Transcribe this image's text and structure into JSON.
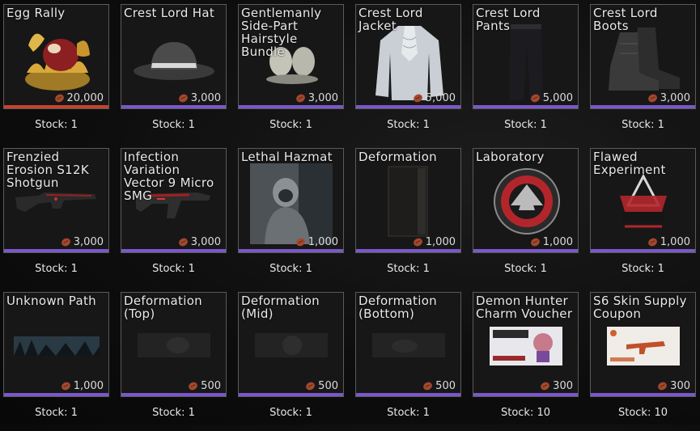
{
  "store": {
    "currency_icon": "crimson-coin-icon",
    "items": [
      {
        "name": "Egg Rally",
        "price": "20,000",
        "stock": "Stock: 1",
        "rarity_color": "#c5432c",
        "icon": "golden-egg-nest"
      },
      {
        "name": "Crest Lord Hat",
        "price": "3,000",
        "stock": "Stock: 1",
        "rarity_color": "#7a58c8",
        "icon": "fedora-hat"
      },
      {
        "name": "Gentlemanly Side-Part Hairstyle Bundle",
        "price": "3,000",
        "stock": "Stock: 1",
        "rarity_color": "#7a58c8",
        "icon": "hairstyle-bundle"
      },
      {
        "name": "Crest Lord Jacket",
        "price": "5,000",
        "stock": "Stock: 1",
        "rarity_color": "#7a58c8",
        "icon": "ruffled-shirt"
      },
      {
        "name": "Crest Lord Pants",
        "price": "5,000",
        "stock": "Stock: 1",
        "rarity_color": "#7a58c8",
        "icon": "dark-pants"
      },
      {
        "name": "Crest Lord Boots",
        "price": "3,000",
        "stock": "Stock: 1",
        "rarity_color": "#7a58c8",
        "icon": "leather-boots"
      },
      {
        "name": "Frenzied Erosion S12K Shotgun",
        "price": "3,000",
        "stock": "Stock: 1",
        "rarity_color": "#7a58c8",
        "icon": "shotgun"
      },
      {
        "name": "Infection Variation Vector 9 Micro SMG",
        "price": "3,000",
        "stock": "Stock: 1",
        "rarity_color": "#7a58c8",
        "icon": "smg"
      },
      {
        "name": "Lethal Hazmat",
        "price": "1,000",
        "stock": "Stock: 1",
        "rarity_color": "#7a58c8",
        "icon": "hazmat-soldier"
      },
      {
        "name": "Deformation",
        "price": "1,000",
        "stock": "Stock: 1",
        "rarity_color": "#7a58c8",
        "icon": "dark-panel"
      },
      {
        "name": "Laboratory",
        "price": "1,000",
        "stock": "Stock: 1",
        "rarity_color": "#7a58c8",
        "icon": "laboratory-emblem"
      },
      {
        "name": "Flawed Experiment",
        "price": "1,000",
        "stock": "Stock: 1",
        "rarity_color": "#7a58c8",
        "icon": "laboratory-spray"
      },
      {
        "name": "Unknown Path",
        "price": "1,000",
        "stock": "Stock: 1",
        "rarity_color": "#7a58c8",
        "icon": "forest-banner"
      },
      {
        "name": "Deformation (Top)",
        "price": "500",
        "stock": "Stock: 1",
        "rarity_color": "#7a58c8",
        "icon": "dark-banner"
      },
      {
        "name": "Deformation (Mid)",
        "price": "500",
        "stock": "Stock: 1",
        "rarity_color": "#7a58c8",
        "icon": "dark-banner"
      },
      {
        "name": "Deformation (Bottom)",
        "price": "500",
        "stock": "Stock: 1",
        "rarity_color": "#7a58c8",
        "icon": "dark-banner"
      },
      {
        "name": "Demon Hunter Charm Voucher",
        "price": "300",
        "stock": "Stock: 10",
        "rarity_color": "#7a58c8",
        "icon": "charm-voucher"
      },
      {
        "name": "S6 Skin Supply Coupon",
        "price": "300",
        "stock": "Stock: 10",
        "rarity_color": "#7a58c8",
        "icon": "skin-coupon"
      }
    ]
  }
}
